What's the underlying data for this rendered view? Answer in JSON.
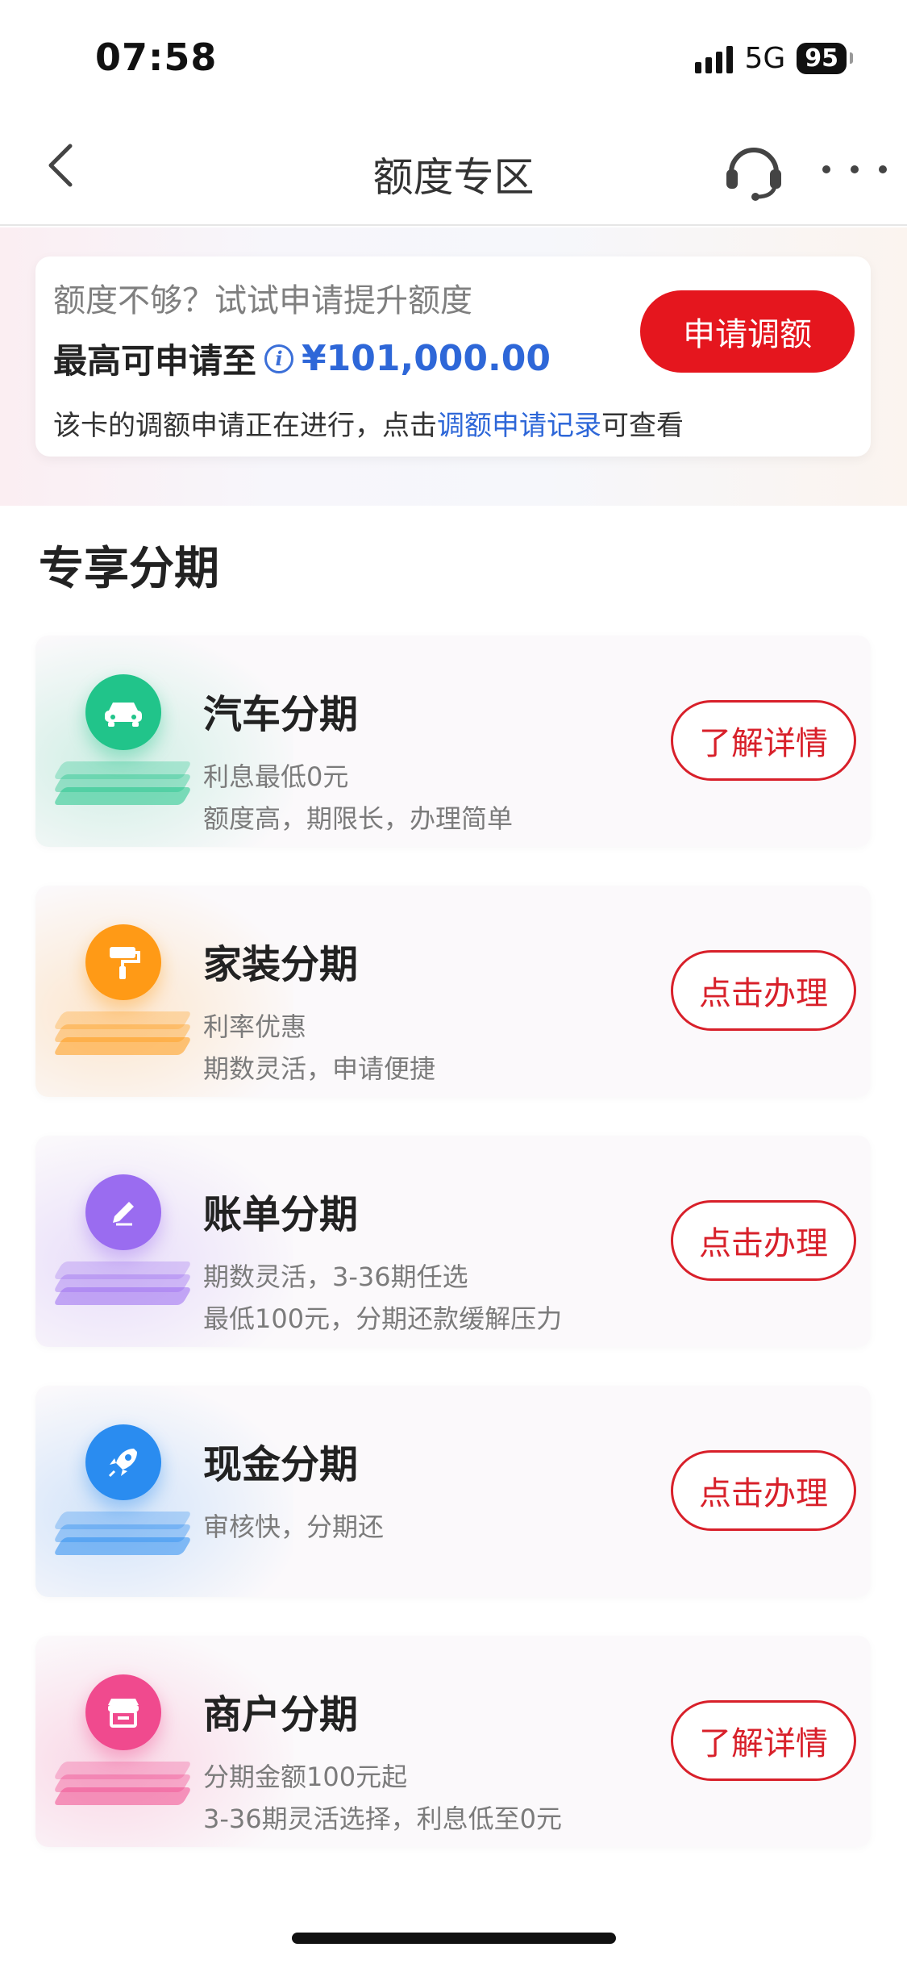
{
  "status_bar": {
    "time": "07:58",
    "network": "5G",
    "battery": "95"
  },
  "nav": {
    "title": "额度专区"
  },
  "credit": {
    "hint": "额度不够？试试申请提升额度",
    "max_label": "最高可申请至",
    "amount": "¥101,000.00",
    "note_prefix": "该卡的调额申请正在进行，点击",
    "note_link": "调额申请记录",
    "note_suffix": "可查看",
    "apply_label": "申请调额"
  },
  "section": {
    "title": "专享分期"
  },
  "cards": [
    {
      "title": "汽车分期",
      "line1": "利息最低0元",
      "line2": "额度高，期限长，办理简单",
      "button": "了解详情",
      "icon": "car-icon",
      "color": "#21c48a"
    },
    {
      "title": "家装分期",
      "line1": "利率优惠",
      "line2": "期数灵活，申请便捷",
      "button": "点击办理",
      "icon": "paint-roller-icon",
      "color": "#ff9a16"
    },
    {
      "title": "账单分期",
      "line1": "期数灵活，3-36期任选",
      "line2": "最低100元，分期还款缓解压力",
      "button": "点击办理",
      "icon": "pencil-icon",
      "color": "#9a6cf0"
    },
    {
      "title": "现金分期",
      "line1": "审核快，分期还",
      "line2": "",
      "button": "点击办理",
      "icon": "rocket-icon",
      "color": "#2a8cf0"
    },
    {
      "title": "商户分期",
      "line1": "分期金额100元起",
      "line2": "3-36期灵活选择，利息低至0元",
      "button": "了解详情",
      "icon": "store-icon",
      "color": "#f04a8e"
    }
  ]
}
